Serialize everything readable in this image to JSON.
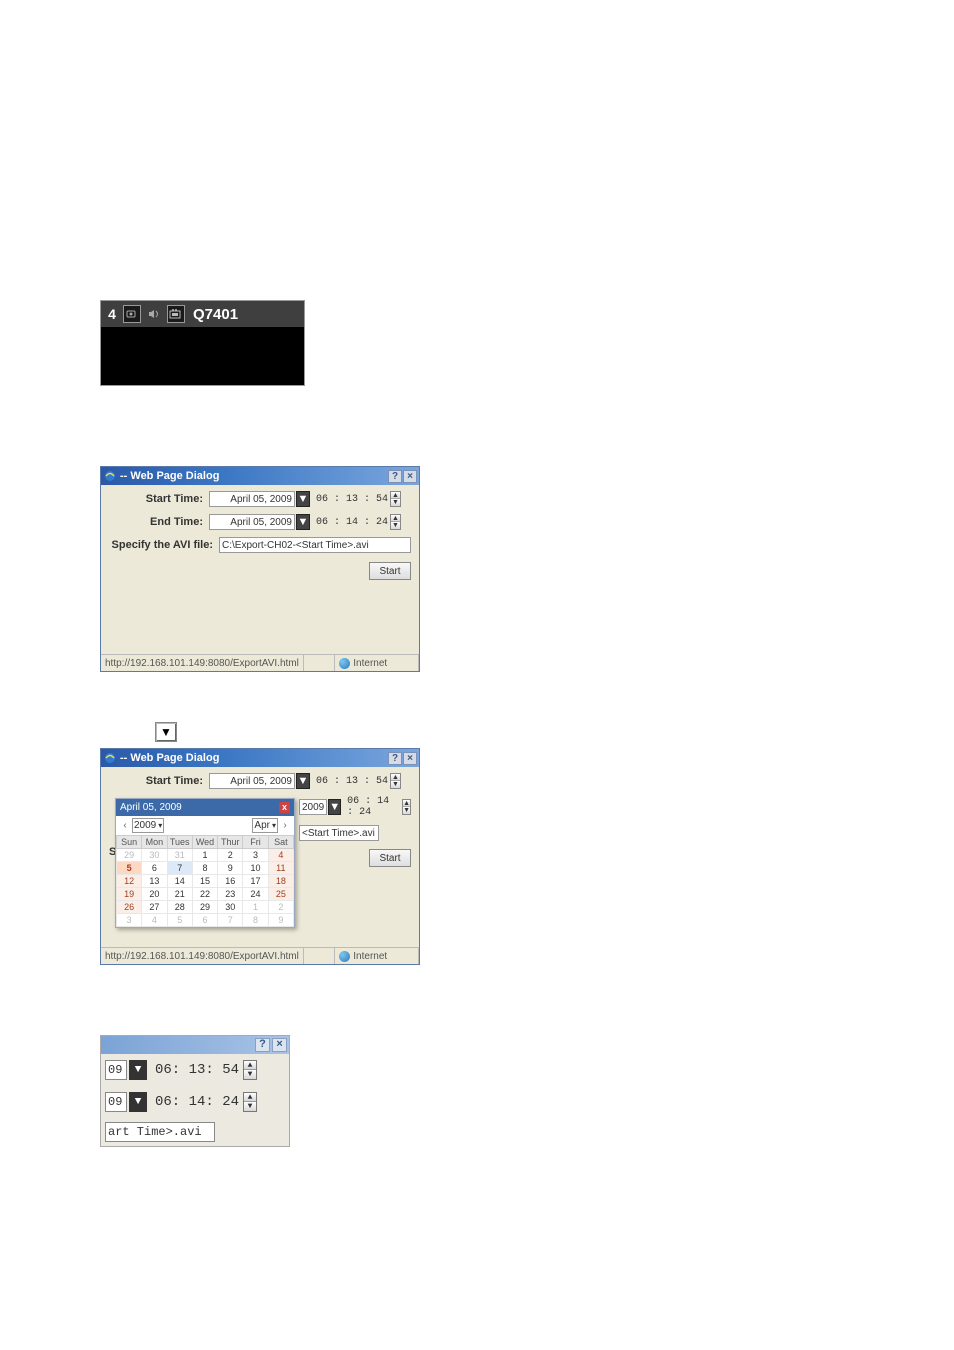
{
  "toolbar": {
    "channel_number": "4",
    "label": "Q7401"
  },
  "dialog_title": "-- Web Page Dialog",
  "labels": {
    "start_time": "Start Time:",
    "end_time": "End Time:",
    "specify_file": "Specify the AVI file:",
    "start_button": "Start"
  },
  "dialog1": {
    "start_date": "April 05, 2009",
    "start_time": "06 : 13 : 54",
    "end_date": "April 05, 2009",
    "end_time": "06 : 14 : 24",
    "file_path": "C:\\Export-CH02-<Start Time>.avi"
  },
  "status": {
    "url": "http://192.168.101.149:8080/ExportAVI.html",
    "zone": "Internet"
  },
  "dialog2": {
    "start_date": "April 05, 2009",
    "start_time": "06 : 13 : 54",
    "end_year": "2009",
    "end_time": "06 : 14 : 24",
    "file_suffix": "<Start Time>.avi"
  },
  "calendar": {
    "month_year": "April 05, 2009",
    "year": "2009",
    "month": "Apr",
    "days_header": [
      "Sun",
      "Mon",
      "Tues",
      "Wed",
      "Thur",
      "Fri",
      "Sat"
    ],
    "weeks": [
      [
        {
          "n": "29",
          "c": "dim"
        },
        {
          "n": "30",
          "c": "dim"
        },
        {
          "n": "31",
          "c": "dim"
        },
        {
          "n": "1",
          "c": ""
        },
        {
          "n": "2",
          "c": ""
        },
        {
          "n": "3",
          "c": ""
        },
        {
          "n": "4",
          "c": "wkend"
        }
      ],
      [
        {
          "n": "5",
          "c": "sel"
        },
        {
          "n": "6",
          "c": ""
        },
        {
          "n": "7",
          "c": "hl"
        },
        {
          "n": "8",
          "c": ""
        },
        {
          "n": "9",
          "c": ""
        },
        {
          "n": "10",
          "c": ""
        },
        {
          "n": "11",
          "c": "wkend"
        }
      ],
      [
        {
          "n": "12",
          "c": "wkend"
        },
        {
          "n": "13",
          "c": ""
        },
        {
          "n": "14",
          "c": ""
        },
        {
          "n": "15",
          "c": ""
        },
        {
          "n": "16",
          "c": ""
        },
        {
          "n": "17",
          "c": ""
        },
        {
          "n": "18",
          "c": "wkend"
        }
      ],
      [
        {
          "n": "19",
          "c": "wkend"
        },
        {
          "n": "20",
          "c": ""
        },
        {
          "n": "21",
          "c": ""
        },
        {
          "n": "22",
          "c": ""
        },
        {
          "n": "23",
          "c": ""
        },
        {
          "n": "24",
          "c": ""
        },
        {
          "n": "25",
          "c": "wkend"
        }
      ],
      [
        {
          "n": "26",
          "c": "wkend"
        },
        {
          "n": "27",
          "c": ""
        },
        {
          "n": "28",
          "c": ""
        },
        {
          "n": "29",
          "c": ""
        },
        {
          "n": "30",
          "c": ""
        },
        {
          "n": "1",
          "c": "dim"
        },
        {
          "n": "2",
          "c": "dim"
        }
      ],
      [
        {
          "n": "3",
          "c": "dim"
        },
        {
          "n": "4",
          "c": "dim"
        },
        {
          "n": "5",
          "c": "dim"
        },
        {
          "n": "6",
          "c": "dim"
        },
        {
          "n": "7",
          "c": "dim"
        },
        {
          "n": "8",
          "c": "dim"
        },
        {
          "n": "9",
          "c": "dim"
        }
      ]
    ],
    "left_gutter": "S"
  },
  "zoom": {
    "r1_field": "09",
    "r1_time": "06: 13: 54",
    "r2_field": "09",
    "r2_time": "06: 14: 24",
    "file_frag": "art Time>.avi"
  }
}
